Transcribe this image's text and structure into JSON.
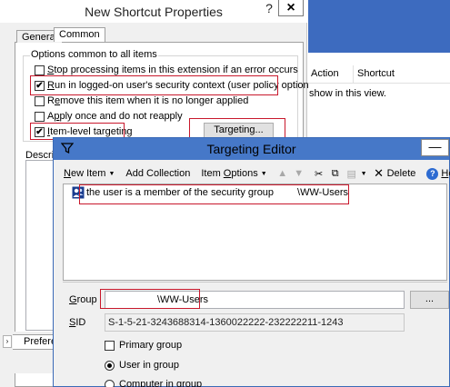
{
  "shortcut_dialog": {
    "title": "New Shortcut Properties",
    "help_glyph": "?",
    "close_glyph": "×",
    "tabs": [
      "General",
      "Common"
    ],
    "options_group_label": "Options common to all items",
    "options": [
      {
        "label": "Stop processing items in this extension if an error occurs",
        "checked": false
      },
      {
        "label": "Run in logged-on user's security context (user policy option)",
        "checked": true
      },
      {
        "label": "Remove this item when it is no longer applied",
        "checked": false
      },
      {
        "label": "Apply once and do not reapply",
        "checked": false
      },
      {
        "label": "Item-level targeting",
        "checked": true
      }
    ],
    "check_glyph": "✔",
    "targeting_button": "Targeting...",
    "description_label": "Descript",
    "preferences_tab": "Prefere",
    "nav_arrow": "›"
  },
  "mmc_pane": {
    "columns": [
      "Action",
      "Shortcut"
    ],
    "empty_message": "show in this view."
  },
  "targeting_editor": {
    "title": "Targeting Editor",
    "minimize_glyph": "—",
    "toolbar": {
      "new_item": "New Item",
      "add_collection": "Add Collection",
      "item_options": "Item Options",
      "delete": "Delete",
      "help": "Help",
      "icons": {
        "up": "▲",
        "down": "▼",
        "cut": "✂",
        "copy": "⧉",
        "paste": "📋",
        "delete_x": "✕",
        "help_q": "?"
      }
    },
    "item_text": "the user is a member of the security group",
    "item_group": "\\WW-Users",
    "group_label": "Group",
    "group_value": "\\WW-Users",
    "browse_button": "...",
    "sid_label": "SID",
    "sid_value": "S-1-5-21-3243688314-1360022222-232222211-1243",
    "primary_group_label": "Primary group",
    "user_in_group_label": "User in group",
    "computer_in_group_label": "Computer in group"
  },
  "colors": {
    "highlight": "#c8182c",
    "title_bar": "#4678c8",
    "accent": "#3d6bbf"
  }
}
